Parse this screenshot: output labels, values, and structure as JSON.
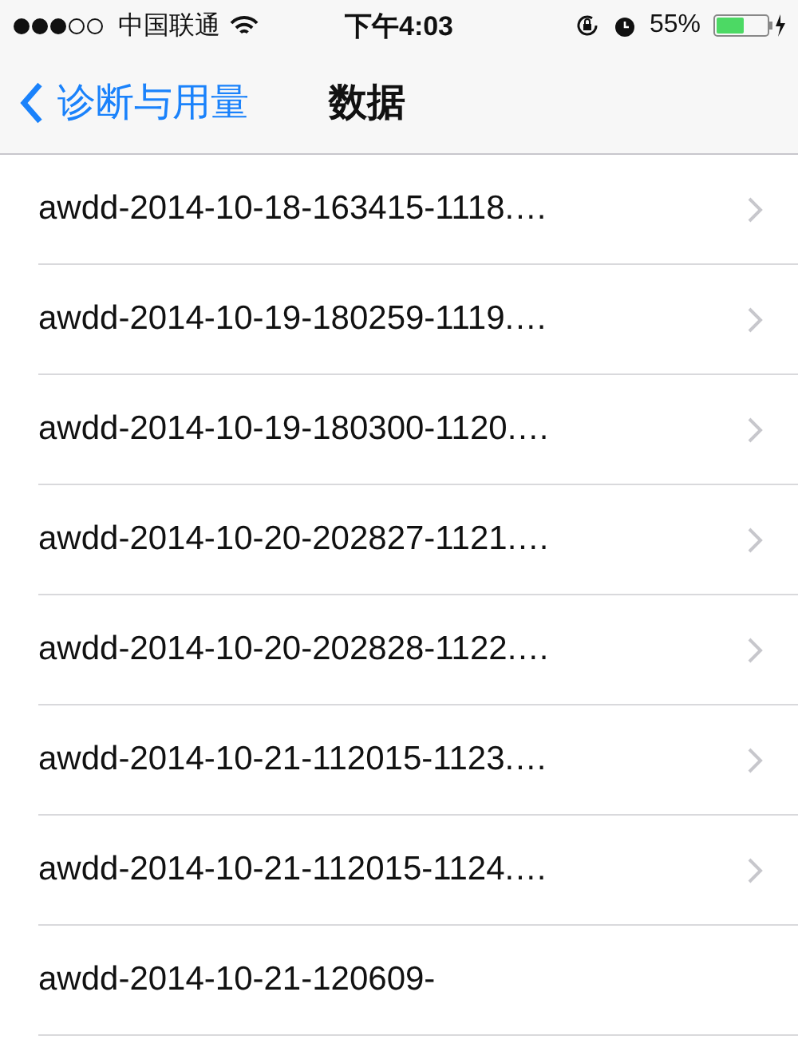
{
  "status_bar": {
    "carrier": "中国联通",
    "time": "下午4:03",
    "battery": "55%"
  },
  "nav": {
    "back": "诊断与用量",
    "title": "数据"
  },
  "rows": [
    {
      "label": "awdd-2014-10-18-163415-1118.…",
      "disclosure": true
    },
    {
      "label": "awdd-2014-10-19-180259-1119.…",
      "disclosure": true
    },
    {
      "label": "awdd-2014-10-19-180300-1120.…",
      "disclosure": true
    },
    {
      "label": "awdd-2014-10-20-202827-1121.…",
      "disclosure": true
    },
    {
      "label": "awdd-2014-10-20-202828-1122.…",
      "disclosure": true
    },
    {
      "label": "awdd-2014-10-21-112015-1123.…",
      "disclosure": true
    },
    {
      "label": "awdd-2014-10-21-112015-1124.…",
      "disclosure": true
    },
    {
      "label": "awdd-2014-10-21-120609-",
      "disclosure": false
    }
  ]
}
